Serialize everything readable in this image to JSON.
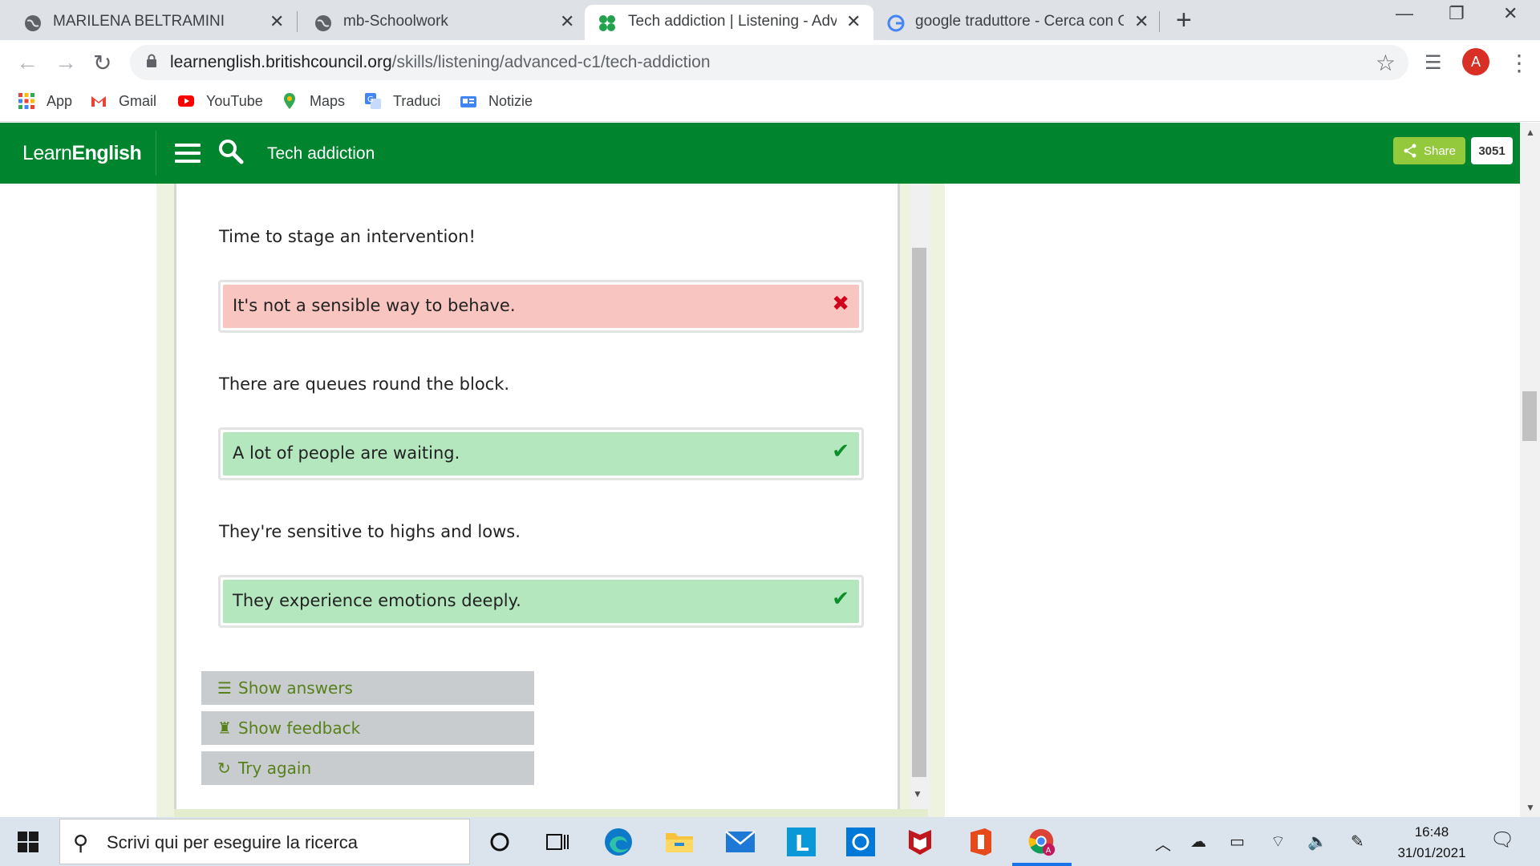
{
  "browser": {
    "tabs": [
      {
        "title": "MARILENA BELTRAMINI",
        "icon": "globe-icon",
        "active": false
      },
      {
        "title": "mb-Schoolwork",
        "icon": "globe-icon",
        "active": false
      },
      {
        "title": "Tech addiction | Listening - Advar",
        "icon": "learnenglish-icon",
        "active": true
      },
      {
        "title": "google traduttore - Cerca con Gc",
        "icon": "google-icon",
        "active": false
      }
    ],
    "url_domain": "learnenglish.britishcouncil.org",
    "url_path": "/skills/listening/advanced-c1/tech-addiction",
    "profile_initial": "A"
  },
  "bookmarks": [
    {
      "label": "App",
      "icon": "apps-grid-icon"
    },
    {
      "label": "Gmail",
      "icon": "gmail-icon"
    },
    {
      "label": "YouTube",
      "icon": "youtube-icon"
    },
    {
      "label": "Maps",
      "icon": "maps-icon"
    },
    {
      "label": "Traduci",
      "icon": "translate-icon"
    },
    {
      "label": "Notizie",
      "icon": "news-icon"
    }
  ],
  "site": {
    "logo_light": "Learn",
    "logo_bold": "English",
    "page_title": "Tech addiction",
    "share_label": "Share",
    "share_count": "3051"
  },
  "exercise": {
    "items": [
      {
        "prompt": "Time to stage an intervention!",
        "answer": "It's not a sensible way to behave.",
        "correct": false
      },
      {
        "prompt": "There are queues round the block.",
        "answer": "A lot of people are waiting.",
        "correct": true
      },
      {
        "prompt": "They're sensitive to highs and lows.",
        "answer": "They experience emotions deeply.",
        "correct": true
      }
    ],
    "buttons": {
      "show_answers": "Show answers",
      "show_feedback": "Show feedback",
      "try_again": "Try again"
    }
  },
  "taskbar": {
    "search_placeholder": "Scrivi qui per eseguire la ricerca",
    "time": "16:48",
    "date": "31/01/2021"
  },
  "colors": {
    "site_green": "#00852e",
    "share_green": "#95c93d",
    "wrong_bg": "#f8c5c0",
    "right_bg": "#b5e7bf",
    "button_text": "#58801b"
  }
}
